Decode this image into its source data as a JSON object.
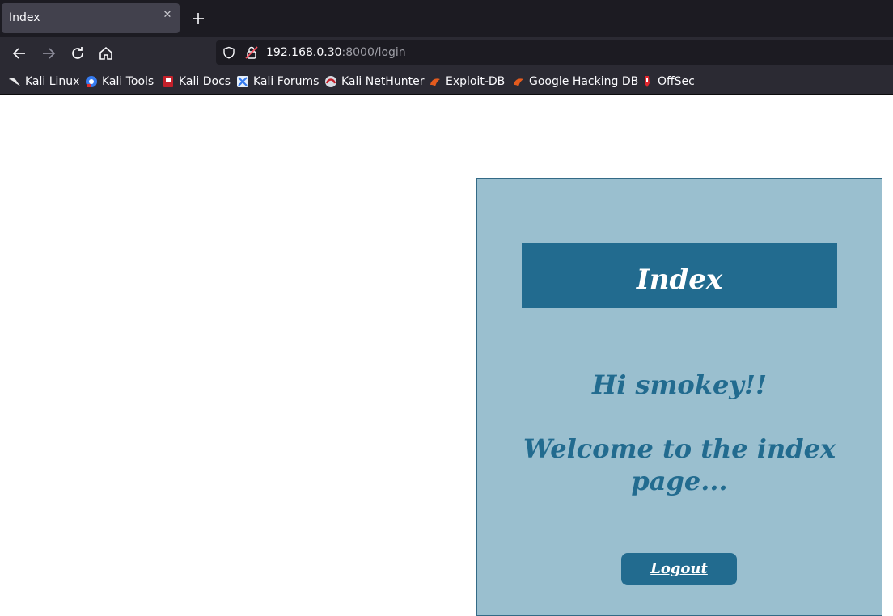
{
  "browser": {
    "tab": {
      "title": "Index",
      "close_icon": "close-icon"
    },
    "new_tab_icon": "plus-icon",
    "nav": {
      "back_icon": "arrow-left-icon",
      "forward_icon": "arrow-right-icon",
      "reload_icon": "reload-icon",
      "home_icon": "home-icon"
    },
    "url": {
      "host": "192.168.0.30",
      "rest": ":8000/login"
    },
    "bookmarks": [
      {
        "label": "Kali Linux",
        "icon": "kali-dragon-icon"
      },
      {
        "label": "Kali Tools",
        "icon": "kali-tools-icon"
      },
      {
        "label": "Kali Docs",
        "icon": "kali-docs-icon"
      },
      {
        "label": "Kali Forums",
        "icon": "kali-forums-icon"
      },
      {
        "label": "Kali NetHunter",
        "icon": "kali-nethunter-icon"
      },
      {
        "label": "Exploit-DB",
        "icon": "exploit-db-icon"
      },
      {
        "label": "Google Hacking DB",
        "icon": "ghdb-icon"
      },
      {
        "label": "OffSec",
        "icon": "offsec-icon"
      }
    ]
  },
  "page": {
    "header": "Index",
    "greeting": "Hi smokey!!",
    "welcome": "Welcome to the index page...",
    "logout_label": "Logout",
    "colors": {
      "panel_bg": "#9abfcf",
      "accent": "#226b8f",
      "text_on_accent": "#ffffff"
    }
  }
}
